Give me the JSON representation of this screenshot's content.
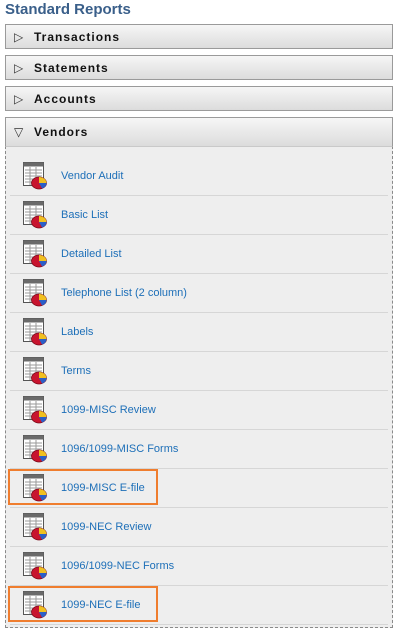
{
  "title": "Standard Reports",
  "sections": [
    {
      "label": "Transactions",
      "state": "collapsed",
      "arrow": "▷"
    },
    {
      "label": "Statements",
      "state": "collapsed",
      "arrow": "▷"
    },
    {
      "label": "Accounts",
      "state": "collapsed",
      "arrow": "▷"
    },
    {
      "label": "Vendors",
      "state": "expanded",
      "arrow": "▽"
    }
  ],
  "vendor_reports": [
    {
      "label": "Vendor Audit",
      "icon": "report-icon"
    },
    {
      "label": "Basic List",
      "icon": "report-icon"
    },
    {
      "label": "Detailed List",
      "icon": "report-icon"
    },
    {
      "label": "Telephone List (2 column)",
      "icon": "report-icon"
    },
    {
      "label": "Labels",
      "icon": "report-icon"
    },
    {
      "label": "Terms",
      "icon": "report-icon"
    },
    {
      "label": "1099-MISC Review",
      "icon": "report-icon"
    },
    {
      "label": "1096/1099-MISC Forms",
      "icon": "report-icon"
    },
    {
      "label": "1099-MISC E-file",
      "icon": "report-icon",
      "highlighted": true
    },
    {
      "label": "1099-NEC Review",
      "icon": "report-icon"
    },
    {
      "label": "1096/1099-NEC Forms",
      "icon": "report-icon"
    },
    {
      "label": "1099-NEC E-file",
      "icon": "report-icon",
      "highlighted": true
    }
  ],
  "colors": {
    "title": "#3a5f8a",
    "link": "#1d6fb8",
    "highlight": "#ef7d2e"
  }
}
